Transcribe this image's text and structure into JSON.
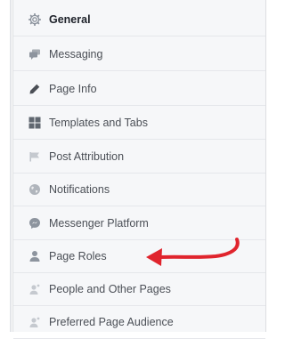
{
  "colors": {
    "sidebar_bg": "#f6f7f9",
    "label_text": "#4b4f56",
    "active_text": "#1d2129",
    "icon_gray": "#8d949e",
    "arrow_red": "#e0242d"
  },
  "menu": {
    "items": [
      {
        "label": "General",
        "icon": "gear-icon",
        "active": true
      },
      {
        "label": "Messaging",
        "icon": "chat-bubbles-icon",
        "active": false
      },
      {
        "label": "Page Info",
        "icon": "pencil-icon",
        "active": false
      },
      {
        "label": "Templates and Tabs",
        "icon": "grid-icon",
        "active": false
      },
      {
        "label": "Post Attribution",
        "icon": "flag-icon",
        "active": false
      },
      {
        "label": "Notifications",
        "icon": "globe-icon",
        "active": false
      },
      {
        "label": "Messenger Platform",
        "icon": "messenger-icon",
        "active": false
      },
      {
        "label": "Page Roles",
        "icon": "person-icon",
        "active": false
      },
      {
        "label": "People and Other Pages",
        "icon": "person-star-icon",
        "active": false
      },
      {
        "label": "Preferred Page Audience",
        "icon": "person-star-icon",
        "active": false
      }
    ]
  },
  "annotation": {
    "type": "arrow",
    "color": "#e0242d",
    "points_to": "Page Roles"
  }
}
